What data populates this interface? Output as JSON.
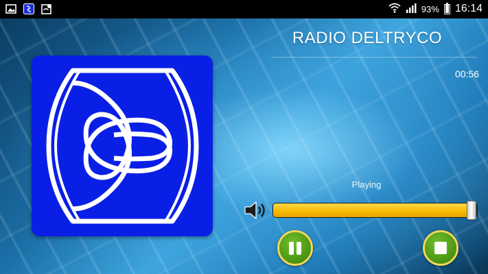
{
  "statusbar": {
    "battery_text": "93%",
    "time": "16:14",
    "icons": [
      "image-notification-icon",
      "app-notification-icon",
      "map-notification-icon",
      "wifi-icon",
      "signal-icon",
      "battery-icon"
    ]
  },
  "player": {
    "title": "RADIO DELTRYCO",
    "elapsed": "00:56",
    "status": "Playing",
    "volume_level": 0.97,
    "controls": {
      "pause_icon": "pause-icon",
      "stop_icon": "stop-icon",
      "volume_icon": "speaker-icon"
    }
  },
  "colors": {
    "art_background": "#0a1fe6",
    "slider_fill": "#f5b800",
    "button_green": "#4f9a16",
    "button_ring": "#f0d65a"
  }
}
